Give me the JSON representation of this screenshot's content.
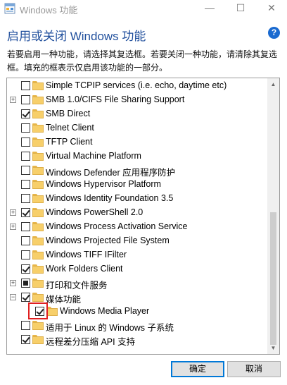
{
  "window": {
    "title": "Windows 功能",
    "min_glyph": "—",
    "max_glyph": "☐",
    "close_glyph": "✕"
  },
  "header": {
    "title": "启用或关闭 Windows 功能",
    "help_glyph": "?"
  },
  "description": "若要启用一种功能，请选择其复选框。若要关闭一种功能，请清除其复选框。填充的框表示仅启用该功能的一部分。",
  "features": [
    {
      "label": "Simple TCPIP services (i.e. echo, daytime etc)",
      "state": "unchecked",
      "expander": ""
    },
    {
      "label": "SMB 1.0/CIFS File Sharing Support",
      "state": "unchecked",
      "expander": "+"
    },
    {
      "label": "SMB Direct",
      "state": "checked",
      "expander": ""
    },
    {
      "label": "Telnet Client",
      "state": "unchecked",
      "expander": ""
    },
    {
      "label": "TFTP Client",
      "state": "unchecked",
      "expander": ""
    },
    {
      "label": "Virtual Machine Platform",
      "state": "unchecked",
      "expander": ""
    },
    {
      "label": "Windows Defender 应用程序防护",
      "state": "unchecked",
      "expander": ""
    },
    {
      "label": "Windows Hypervisor Platform",
      "state": "unchecked",
      "expander": ""
    },
    {
      "label": "Windows Identity Foundation 3.5",
      "state": "unchecked",
      "expander": ""
    },
    {
      "label": "Windows PowerShell 2.0",
      "state": "checked",
      "expander": "+"
    },
    {
      "label": "Windows Process Activation Service",
      "state": "unchecked",
      "expander": "+"
    },
    {
      "label": "Windows Projected File System",
      "state": "unchecked",
      "expander": ""
    },
    {
      "label": "Windows TIFF IFilter",
      "state": "unchecked",
      "expander": ""
    },
    {
      "label": "Work Folders Client",
      "state": "checked",
      "expander": ""
    },
    {
      "label": "打印和文件服务",
      "state": "partial",
      "expander": "+"
    },
    {
      "label": "媒体功能",
      "state": "checked",
      "expander": "−"
    },
    {
      "label": "Windows Media Player",
      "state": "checked",
      "expander": "",
      "child": true
    },
    {
      "label": "适用于 Linux 的 Windows 子系统",
      "state": "unchecked",
      "expander": ""
    },
    {
      "label": "远程差分压缩 API 支持",
      "state": "checked",
      "expander": ""
    }
  ],
  "scrollbar": {
    "up_glyph": "▲",
    "down_glyph": "▼"
  },
  "buttons": {
    "ok": "确定",
    "cancel": "取消"
  },
  "colors": {
    "header": "#1f4e9c",
    "help": "#1a6ad0",
    "folder": "#f7cf6a",
    "highlight": "#e02020"
  }
}
